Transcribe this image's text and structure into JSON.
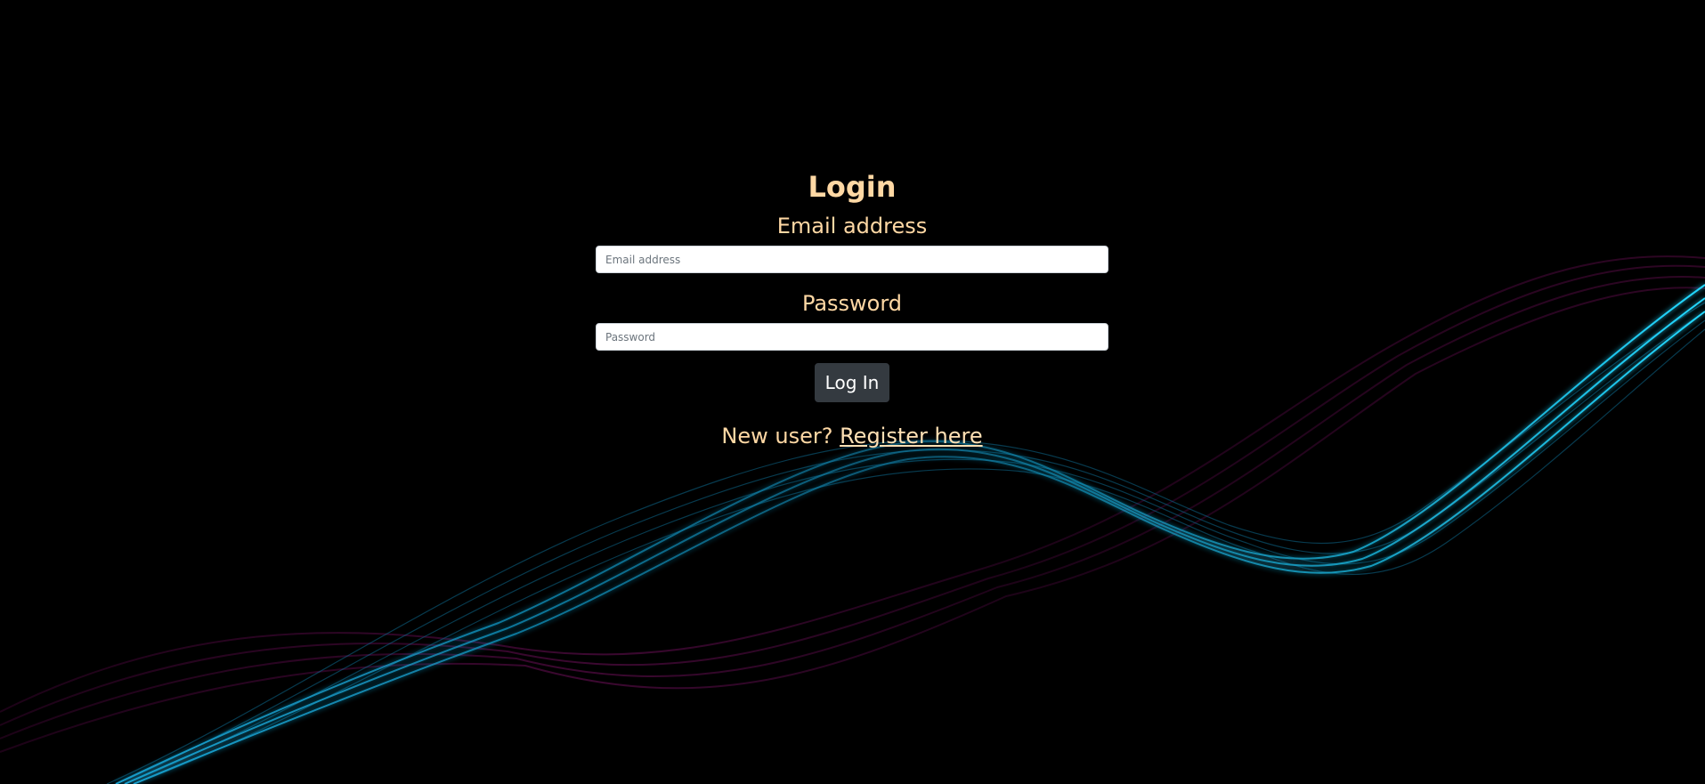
{
  "login": {
    "title": "Login",
    "email_label": "Email address",
    "email_placeholder": "Email address",
    "email_value": "",
    "password_label": "Password",
    "password_placeholder": "Password",
    "password_value": "",
    "submit_label": "Log In",
    "register_prompt": "New user?",
    "register_link": "Register here"
  },
  "theme": {
    "background": "#000000",
    "text_color": "#ffd8a4",
    "button_bg": "#343a40",
    "wave_cyan": "#1fd5ff",
    "wave_magenta": "#d41cc9"
  }
}
